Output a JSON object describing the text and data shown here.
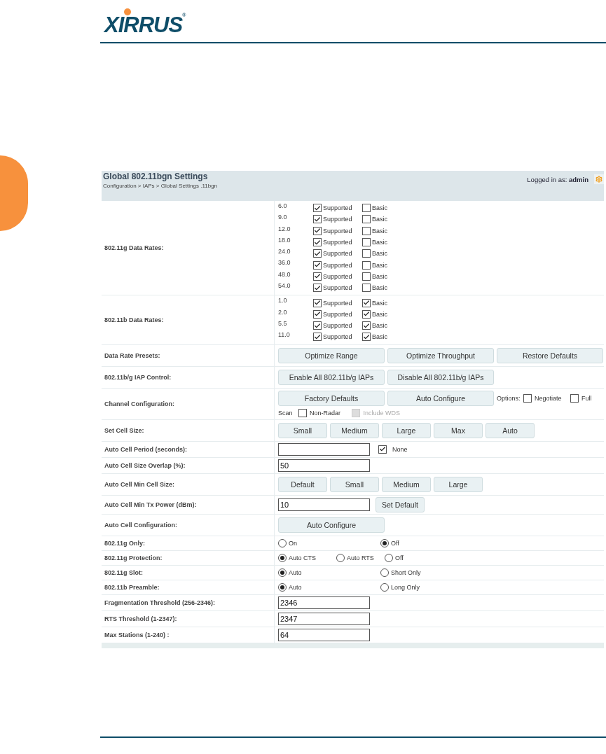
{
  "logo": "XIRRUS$^{®}$",
  "panel": {
    "title": "Global 802.11bgn Settings",
    "breadcrumb": "Configuration > IAPs > Global Settings .11bgn",
    "logged_in_label": "Logged in as:",
    "user": "admin"
  },
  "rows": [
    {
      "kind": "rates",
      "label": "802.11g Data Rates:",
      "rates": [
        {
          "rate": "6.0",
          "supported": true,
          "supported_label": "Supported",
          "basic": false,
          "basic_label": "Basic"
        },
        {
          "rate": "9.0",
          "supported": true,
          "supported_label": "Supported",
          "basic": false,
          "basic_label": "Basic"
        },
        {
          "rate": "12.0",
          "supported": true,
          "supported_label": "Supported",
          "basic": false,
          "basic_label": "Basic"
        },
        {
          "rate": "18.0",
          "supported": true,
          "supported_label": "Supported",
          "basic": false,
          "basic_label": "Basic"
        },
        {
          "rate": "24.0",
          "supported": true,
          "supported_label": "Supported",
          "basic": false,
          "basic_label": "Basic"
        },
        {
          "rate": "36.0",
          "supported": true,
          "supported_label": "Supported",
          "basic": false,
          "basic_label": "Basic"
        },
        {
          "rate": "48.0",
          "supported": true,
          "supported_label": "Supported",
          "basic": false,
          "basic_label": "Basic"
        },
        {
          "rate": "54.0",
          "supported": true,
          "supported_label": "Supported",
          "basic": false,
          "basic_label": "Basic"
        }
      ]
    },
    {
      "kind": "rates",
      "label": "802.11b Data Rates:",
      "rates": [
        {
          "rate": "1.0",
          "supported": true,
          "supported_label": "Supported",
          "basic": true,
          "basic_label": "Basic"
        },
        {
          "rate": "2.0",
          "supported": true,
          "supported_label": "Supported",
          "basic": true,
          "basic_label": "Basic"
        },
        {
          "rate": "5.5",
          "supported": true,
          "supported_label": "Supported",
          "basic": true,
          "basic_label": "Basic"
        },
        {
          "rate": "11.0",
          "supported": true,
          "supported_label": "Supported",
          "basic": true,
          "basic_label": "Basic"
        }
      ]
    },
    {
      "kind": "buttons",
      "label": "Data Rate Presets:",
      "buttons": [
        "Optimize Range",
        "Optimize Throughput",
        "Restore Defaults"
      ]
    },
    {
      "kind": "buttons",
      "label": "802.11b/g IAP Control:",
      "buttons": [
        "Enable All 802.11b/g IAPs",
        "Disable All 802.11b/g IAPs"
      ]
    },
    {
      "kind": "channel",
      "label": "Channel Configuration:",
      "buttons": [
        "Factory Defaults",
        "Auto Configure"
      ],
      "options_label": "Options:",
      "options": [
        {
          "label": "Negotiate",
          "checked": false
        },
        {
          "label": "Full",
          "checked": false
        }
      ],
      "scan_label": "Scan",
      "scan_options": [
        {
          "label": "Non-Radar",
          "checked": false,
          "disabled": false
        },
        {
          "label": "Include WDS",
          "checked": false,
          "disabled": true
        }
      ]
    },
    {
      "kind": "small_buttons",
      "label": "Set Cell Size:",
      "buttons": [
        "Small",
        "Medium",
        "Large",
        "Max",
        "Auto"
      ]
    },
    {
      "kind": "input",
      "label": "Auto Cell Period (seconds):",
      "value": "",
      "checkbox": {
        "label": "None",
        "checked": true
      }
    },
    {
      "kind": "input",
      "label": "Auto Cell Size Overlap (%):",
      "value": "50"
    },
    {
      "kind": "small_buttons",
      "label": "Auto Cell Min Cell Size:",
      "buttons": [
        "Default",
        "Small",
        "Medium",
        "Large"
      ]
    },
    {
      "kind": "input",
      "label": "Auto Cell Min Tx Power (dBm):",
      "value": "10",
      "button": "Set Default"
    },
    {
      "kind": "buttons",
      "label": "Auto Cell Configuration:",
      "buttons": [
        "Auto Configure"
      ]
    },
    {
      "kind": "radios",
      "label": "802.11g Only:",
      "options": [
        {
          "label": "On",
          "selected": false
        },
        {
          "label": "Off",
          "selected": true
        }
      ]
    },
    {
      "kind": "radios",
      "label": "802.11g Protection:",
      "options": [
        {
          "label": "Auto CTS",
          "selected": true
        },
        {
          "label": "Auto RTS",
          "selected": false
        },
        {
          "label": "Off",
          "selected": false
        }
      ]
    },
    {
      "kind": "radios",
      "label": "802.11g Slot:",
      "options": [
        {
          "label": "Auto",
          "selected": true
        },
        {
          "label": "Short Only",
          "selected": false
        }
      ]
    },
    {
      "kind": "radios",
      "label": "802.11b Preamble:",
      "options": [
        {
          "label": "Auto",
          "selected": true
        },
        {
          "label": "Long Only",
          "selected": false
        }
      ]
    },
    {
      "kind": "input",
      "label": "Fragmentation Threshold (256-2346):",
      "value": "2346"
    },
    {
      "kind": "input",
      "label": "RTS Threshold (1-2347):",
      "value": "2347"
    },
    {
      "kind": "input",
      "label": "Max Stations (1-240) :",
      "value": "64"
    }
  ]
}
